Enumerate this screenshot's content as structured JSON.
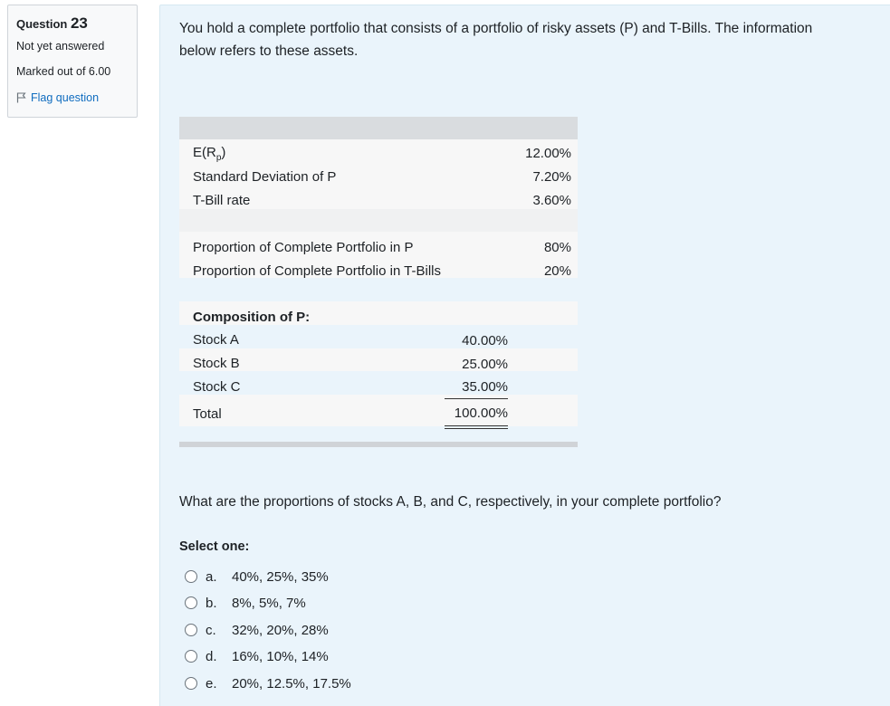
{
  "info": {
    "question_label": "Question",
    "question_number": "23",
    "state": "Not yet answered",
    "mark": "Marked out of 6.00",
    "flag": "Flag question"
  },
  "question": {
    "intro_line1": "You hold a complete portfolio that consists of a portfolio of risky assets (P) and T-Bills. The information",
    "intro_line2": "below refers to these assets.",
    "table": {
      "expected_return_label_pre": "E(R",
      "expected_return_label_sub": "p",
      "expected_return_label_post": ")",
      "expected_return_value": "12.00%",
      "std_dev_label": "Standard Deviation of P",
      "std_dev_value": "7.20%",
      "tbill_label": "T-Bill rate",
      "tbill_value": "3.60%",
      "prop_p_label": "Proportion of  Complete Portfolio in P",
      "prop_p_value": "80%",
      "prop_tbills_label": "Proportion of  Complete Portfolio in T-Bills",
      "prop_tbills_value": "20%",
      "composition_heading": "Composition of P:",
      "stocks": [
        {
          "label": "Stock A",
          "value": "40.00%"
        },
        {
          "label": "Stock B",
          "value": "25.00%"
        },
        {
          "label": "Stock C",
          "value": "35.00%"
        }
      ],
      "total_label": "Total",
      "total_value": "100.00%"
    },
    "prompt": "What are the proportions of stocks A, B, and C, respectively, in your complete portfolio?",
    "select_one": "Select one:",
    "options": [
      {
        "letter": "a.",
        "text": "40%, 25%, 35%"
      },
      {
        "letter": "b.",
        "text": "8%, 5%, 7%"
      },
      {
        "letter": "c.",
        "text": "32%, 20%, 28%"
      },
      {
        "letter": "d.",
        "text": "16%, 10%, 14%"
      },
      {
        "letter": "e.",
        "text": "20%, 12.5%, 17.5%"
      }
    ]
  }
}
